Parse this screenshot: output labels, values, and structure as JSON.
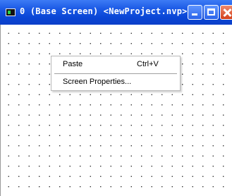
{
  "window": {
    "title": "0 (Base Screen) <NewProject.nvp>"
  },
  "context_menu": {
    "items": [
      {
        "label": "Paste",
        "shortcut": "Ctrl+V"
      },
      {
        "label": "Screen Properties..."
      }
    ]
  },
  "icons": {
    "app": "screen-window-icon",
    "minimize": "minimize-icon",
    "maximize": "maximize-icon",
    "close": "close-icon"
  },
  "colors": {
    "titlebar": "#0a46d6",
    "close_button": "#d3401c",
    "canvas": "#ffffff"
  }
}
